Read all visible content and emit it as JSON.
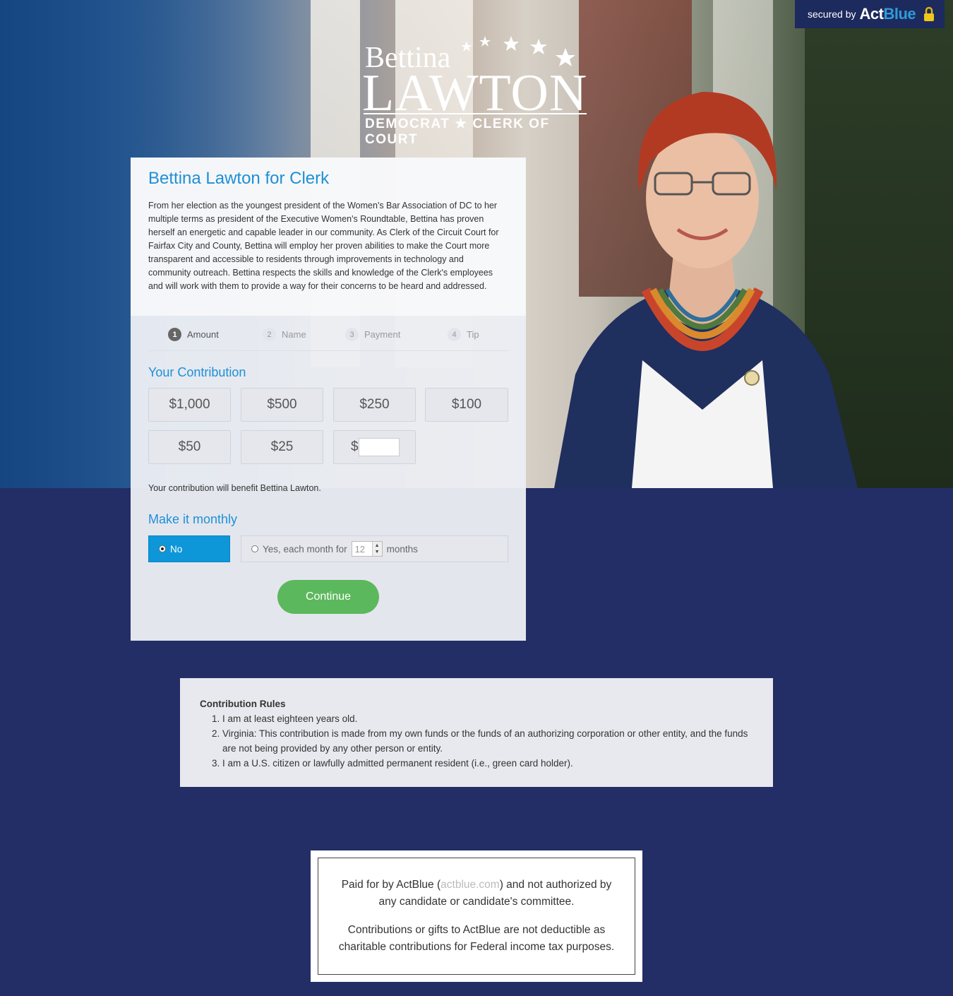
{
  "secured": {
    "label": "secured by",
    "brand_a": "Act",
    "brand_b": "Blue"
  },
  "logo": {
    "first": "Bettina",
    "last": "LAWTON",
    "tagline": "DEMOCRAT ★ CLERK OF COURT"
  },
  "card": {
    "title": "Bettina Lawton for Clerk",
    "description": "From her election as the youngest president of the Women's Bar Association of DC to her multiple terms as president of the Executive Women's Roundtable, Bettina has proven herself an energetic and capable leader in our community. As Clerk of the Circuit Court for Fairfax City and County, Bettina will employ her proven abilities to make the Court more transparent and accessible to residents through improvements in technology and community outreach. Bettina respects the skills and knowledge of the Clerk's employees and will work with them to provide a way for their concerns to be heard and addressed."
  },
  "steps": [
    {
      "num": "1",
      "label": "Amount",
      "active": true
    },
    {
      "num": "2",
      "label": "Name",
      "active": false
    },
    {
      "num": "3",
      "label": "Payment",
      "active": false
    },
    {
      "num": "4",
      "label": "Tip",
      "active": false
    }
  ],
  "contribution": {
    "heading": "Your Contribution",
    "amounts": [
      "$1,000",
      "$500",
      "$250",
      "$100",
      "$50",
      "$25"
    ],
    "custom_prefix": "$",
    "custom_value": "",
    "benefit": "Your contribution will benefit Bettina Lawton."
  },
  "monthly": {
    "heading": "Make it monthly",
    "no_label": "No",
    "yes_label": "Yes, each month for",
    "months_value": "12",
    "months_suffix": "months",
    "selected": "No"
  },
  "continue_label": "Continue",
  "rules": {
    "heading": "Contribution Rules",
    "items": [
      "I am at least eighteen years old.",
      "Virginia: This contribution is made from my own funds or the funds of an authorizing corporation or other entity, and the funds are not being provided by any other person or entity.",
      "I am a U.S. citizen or lawfully admitted permanent resident (i.e., green card holder)."
    ]
  },
  "disclaimer": {
    "line1_pre": "Paid for by ActBlue (",
    "line1_link": "actblue.com",
    "line1_post": ") and not authorized by any candidate or candidate's committee.",
    "line2": "Contributions or gifts to ActBlue are not deductible as charitable contributions for Federal income tax purposes."
  },
  "colors": {
    "accent": "#1e90d6",
    "continue": "#5cb85c",
    "background": "#232e66",
    "selected": "#0d96d8"
  }
}
